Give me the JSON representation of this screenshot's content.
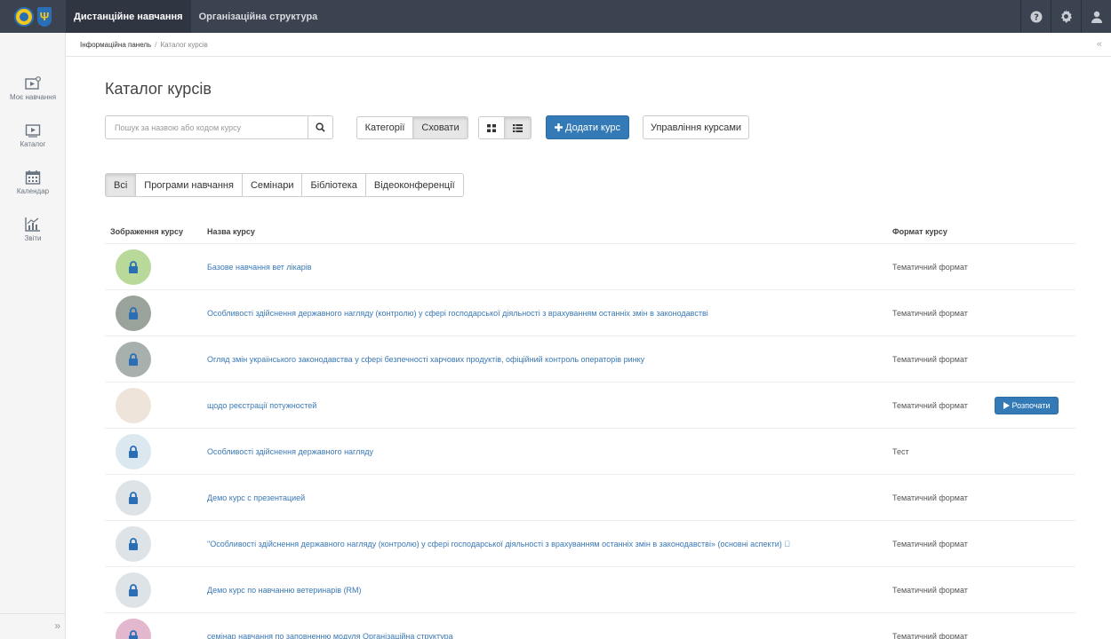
{
  "topbar": {
    "nav": [
      {
        "label": "Дистанційне навчання",
        "active": true
      },
      {
        "label": "Організаційна структура",
        "active": false
      }
    ]
  },
  "sidebar": {
    "items": [
      {
        "label": "Моє навчання",
        "icon": "my-learning-icon"
      },
      {
        "label": "Каталог",
        "icon": "catalog-icon"
      },
      {
        "label": "Календар",
        "icon": "calendar-icon"
      },
      {
        "label": "Звіти",
        "icon": "reports-icon"
      }
    ],
    "expand_glyph": "»"
  },
  "breadcrumb": {
    "home": "Інформаційна панель",
    "separator": "/",
    "current": "Каталог курсів",
    "collapse_glyph": "«"
  },
  "page": {
    "title": "Каталог курсів",
    "search_placeholder": "Пошук за назвою або кодом курсу",
    "toggle": {
      "categories": "Категорії",
      "hide": "Сховати"
    },
    "add_course": "Додати курс",
    "manage_courses": "Управління курсами",
    "filters": [
      "Всі",
      "Програми навчання",
      "Семінари",
      "Бібліотека",
      "Відеоконференції"
    ],
    "active_filter": 0
  },
  "table": {
    "headers": {
      "image": "Зображення курсу",
      "name": "Назва курсу",
      "format": "Формат курсу"
    },
    "start_label": "Розпочати",
    "rows": [
      {
        "name": "Базове навчання вет лікарів",
        "format": "Тематичний формат",
        "avatar_color": "#b9d99a",
        "locked": true,
        "start": false
      },
      {
        "name": "Особливості здійснення державного нагляду (контролю) у сфері господарської діяльності з врахуванням останніх змін в законодавстві",
        "format": "Тематичний формат",
        "avatar_color": "#9aa39b",
        "locked": true,
        "start": false
      },
      {
        "name": "Огляд змін українського законодавства у сфері безпечності харчових продуктів, офіційний контроль операторів ринку",
        "format": "Тематичний формат",
        "avatar_color": "#a7b0ad",
        "locked": true,
        "start": false
      },
      {
        "name": "щодо реєстрації потужностей",
        "format": "Тематичний формат",
        "avatar_color": "#efe4da",
        "locked": false,
        "start": true
      },
      {
        "name": "Особливості здійснення державного нагляду",
        "format": "Тест",
        "avatar_color": "#dbe8ef",
        "locked": true,
        "start": false
      },
      {
        "name": "Демо курс с презентацией",
        "format": "Тематичний формат",
        "avatar_color": "#dde3e6",
        "locked": true,
        "start": false
      },
      {
        "name": "\"Особливості здійснення державного нагляду (контролю) у сфері господарської діяльності з врахуванням останніх змін в законодавстві» (основні аспекти) ⃞",
        "format": "Тематичний формат",
        "avatar_color": "#dde3e6",
        "locked": true,
        "start": false
      },
      {
        "name": "Демо курс по навчанню ветеринарів (RM)",
        "format": "Тематичний формат",
        "avatar_color": "#dde3e6",
        "locked": true,
        "start": false
      },
      {
        "name": "семінар навчання по заповненню модуля Організаційна структура",
        "format": "Тематичний формат",
        "avatar_color": "#e3b8cf",
        "locked": true,
        "start": false
      }
    ]
  },
  "colors": {
    "topbar": "#3b4350",
    "primary": "#337ab7",
    "link": "#3a78b5"
  }
}
